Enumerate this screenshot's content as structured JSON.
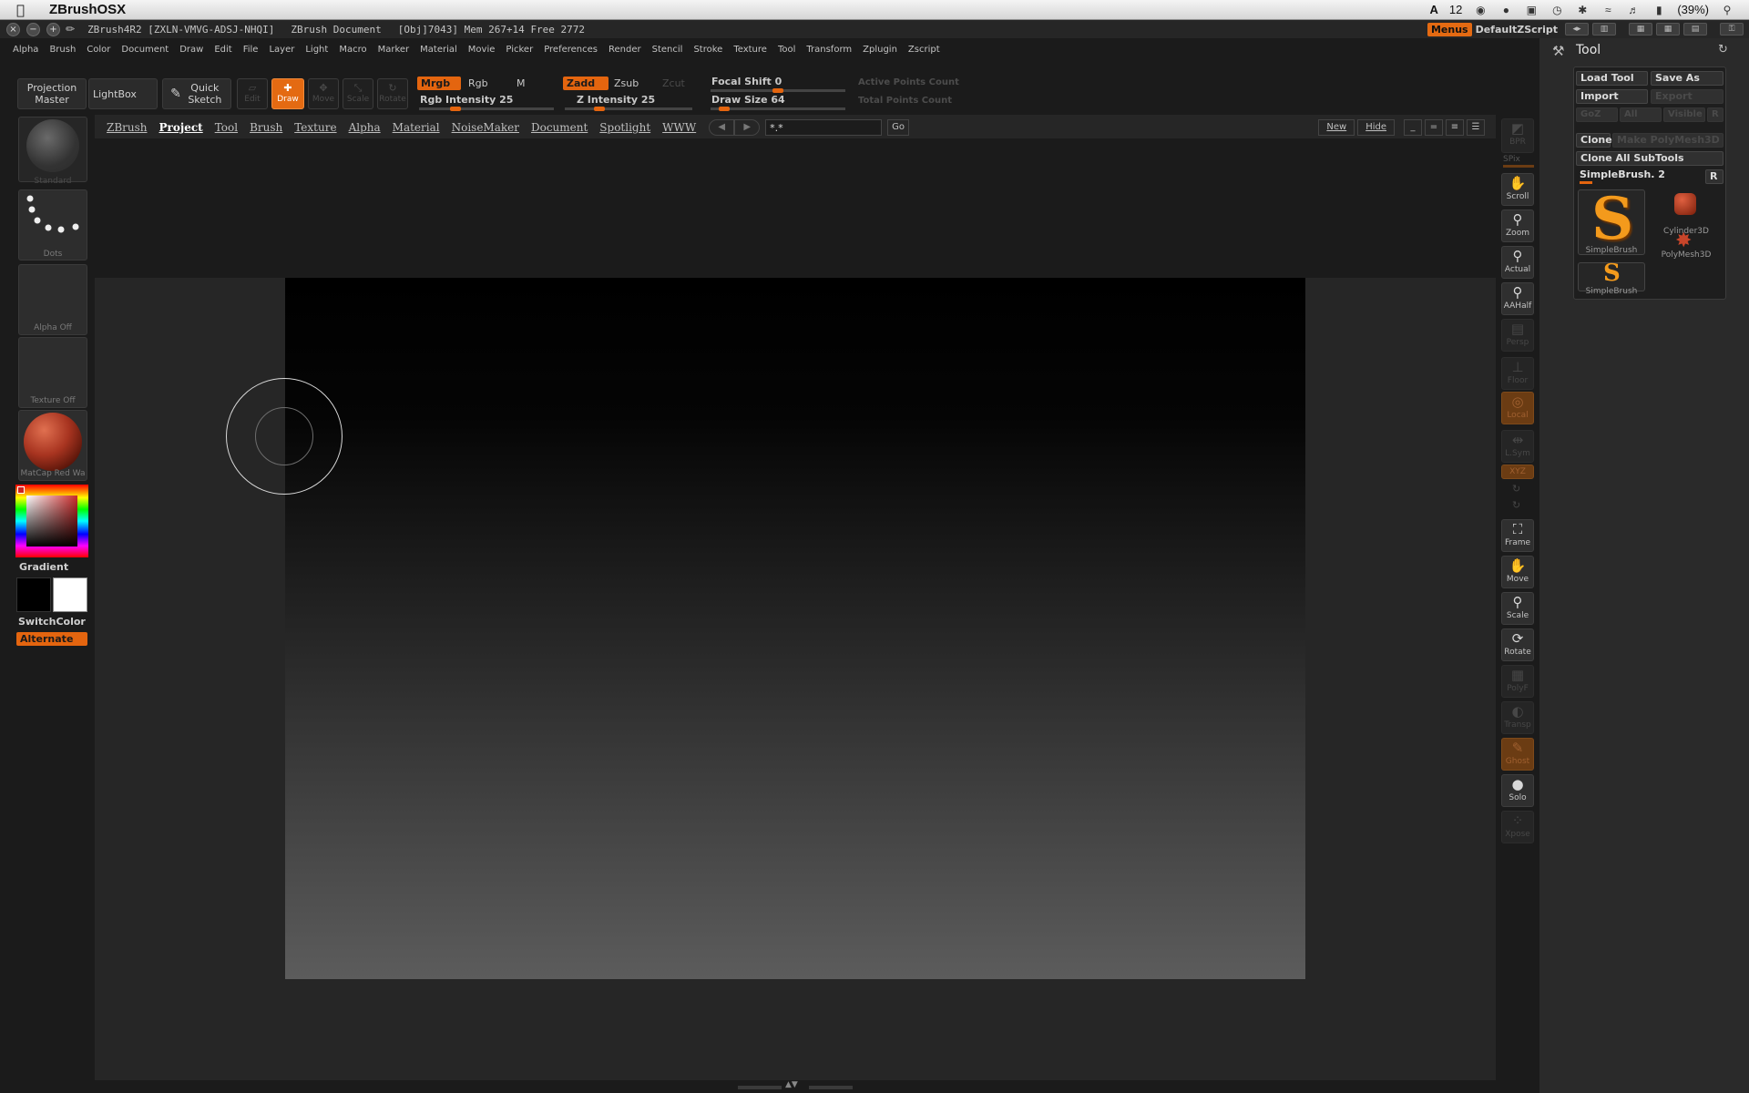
{
  "mac_menubar": {
    "apple": "",
    "app_name": "ZBrushOSX",
    "status": {
      "adobe_count": "12",
      "battery": "(39%)"
    }
  },
  "titlebar": {
    "app_version": "ZBrush4R2",
    "serial": "[ZXLN-VMVG-ADSJ-NHQI]",
    "doc_name": "ZBrush Document",
    "obj": "[Obj]7043]",
    "mem": "Mem 267+14",
    "free": "Free 2772",
    "menus_label": "Menus",
    "script_label": "DefaultZScript"
  },
  "main_menu": [
    "Alpha",
    "Brush",
    "Color",
    "Document",
    "Draw",
    "Edit",
    "File",
    "Layer",
    "Light",
    "Macro",
    "Marker",
    "Material",
    "Movie",
    "Picker",
    "Preferences",
    "Render",
    "Stencil",
    "Stroke",
    "Texture",
    "Tool",
    "Transform",
    "Zplugin",
    "Zscript"
  ],
  "toolbar": {
    "projection_master": "Projection Master",
    "lightbox": "LightBox",
    "quick_sketch": "Quick Sketch",
    "edit": "Edit",
    "draw": "Draw",
    "move": "Move",
    "scale": "Scale",
    "rotate": "Rotate",
    "mrgb": "Mrgb",
    "rgb": "Rgb",
    "m": "M",
    "zadd": "Zadd",
    "zsub": "Zsub",
    "zcut": "Zcut",
    "rgb_intensity": "Rgb Intensity 25",
    "z_intensity": "Z Intensity 25",
    "focal_shift": "Focal Shift 0",
    "draw_size": "Draw Size 64",
    "active_points": "Active Points Count",
    "total_points": "Total Points Count",
    "rgb_intensity_value": 25,
    "z_intensity_value": 25,
    "focal_shift_value": 0,
    "draw_size_value": 64
  },
  "left_shelf": {
    "brush_label": "Standard",
    "stroke_label": "Dots",
    "alpha_label": "Alpha Off",
    "texture_label": "Texture Off",
    "material_label": "MatCap Red Wa",
    "gradient_label": "Gradient",
    "switchcolor_label": "SwitchColor",
    "alternate_label": "Alternate",
    "colors": {
      "material": "#b0361f",
      "main": "#000000",
      "secondary": "#ffffff"
    }
  },
  "doc_tabs": [
    "ZBrush",
    "Project",
    "Tool",
    "Brush",
    "Texture",
    "Alpha",
    "Material",
    "NoiseMaker",
    "Document",
    "Spotlight",
    "WWW"
  ],
  "doc_tabs_active": "Project",
  "doc_controls": {
    "search_value": "*.*",
    "go": "Go",
    "new": "New",
    "hide": "Hide"
  },
  "right_shelf": {
    "bpr": "BPR",
    "spix": "SPix",
    "scroll": "Scroll",
    "zoom": "Zoom",
    "actual": "Actual",
    "aahalf": "AAHalf",
    "persp": "Persp",
    "floor": "Floor",
    "local": "Local",
    "lsym": "L.Sym",
    "xyz": "XYZ",
    "frame": "Frame",
    "move": "Move",
    "scale": "Scale",
    "rotate": "Rotate",
    "polyf": "PolyF",
    "transp": "Transp",
    "ghost": "Ghost",
    "solo": "Solo",
    "xpose": "Xpose"
  },
  "tool_panel": {
    "title": "Tool",
    "load_tool": "Load Tool",
    "save_as": "Save As",
    "import": "Import",
    "export": "Export",
    "goz": "GoZ",
    "all": "All",
    "visible": "Visible",
    "r": "R",
    "clone": "Clone",
    "make_polymesh": "Make PolyMesh3D",
    "clone_all": "Clone All SubTools",
    "current_tool": "SimpleBrush. 2",
    "current_tool_r": "R",
    "thumbs": [
      "SimpleBrush",
      "Cylinder3D",
      "PolyMesh3D",
      "SimpleBrush"
    ]
  }
}
